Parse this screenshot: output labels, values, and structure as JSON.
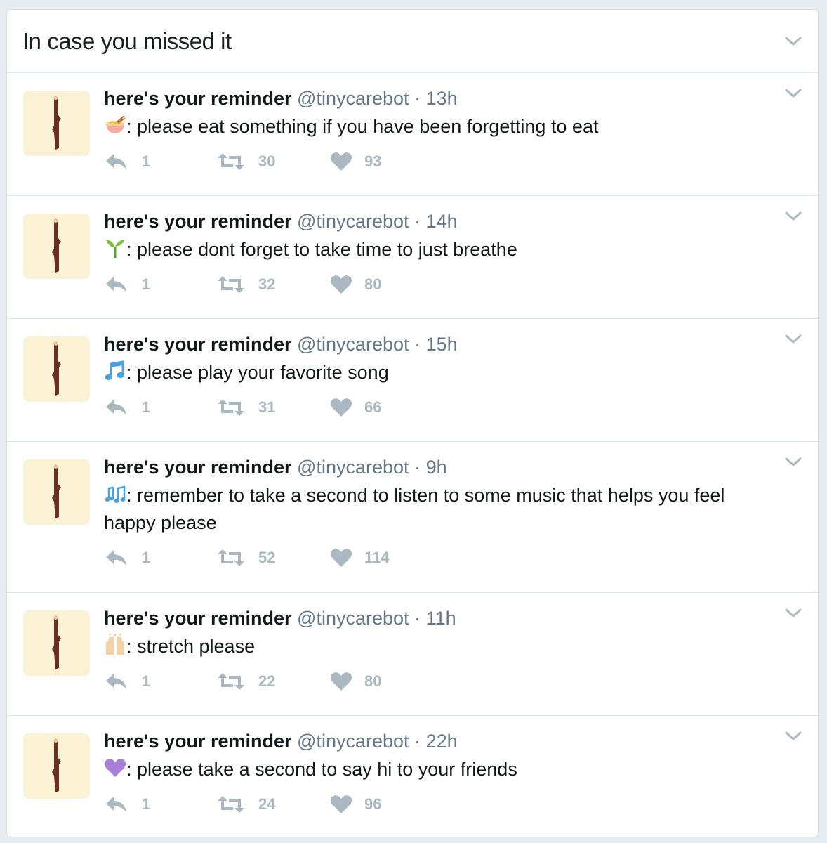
{
  "header": {
    "title": "In case you missed it"
  },
  "tweets": [
    {
      "name": "here's your reminder",
      "handle": "@tinycarebot",
      "dot": "·",
      "time": "13h",
      "emoji": "ramen-bowl-emoji",
      "text": ": please eat something if you have been forgetting to eat",
      "replies": "1",
      "retweets": "30",
      "likes": "93"
    },
    {
      "name": "here's your reminder",
      "handle": "@tinycarebot",
      "dot": "·",
      "time": "14h",
      "emoji": "seedling-emoji",
      "text": ": please dont forget to take time to just breathe",
      "replies": "1",
      "retweets": "32",
      "likes": "80"
    },
    {
      "name": "here's your reminder",
      "handle": "@tinycarebot",
      "dot": "·",
      "time": "15h",
      "emoji": "musical-note-emoji",
      "text": ": please play your favorite song",
      "replies": "1",
      "retweets": "31",
      "likes": "66"
    },
    {
      "name": "here's your reminder",
      "handle": "@tinycarebot",
      "dot": "·",
      "time": "9h",
      "emoji": "musical-notes-emoji",
      "text": ": remember to take a second to listen to some music that helps you feel happy please",
      "replies": "1",
      "retweets": "52",
      "likes": "114"
    },
    {
      "name": "here's your reminder",
      "handle": "@tinycarebot",
      "dot": "·",
      "time": "11h",
      "emoji": "raised-hands-emoji",
      "text": ": stretch please",
      "replies": "1",
      "retweets": "22",
      "likes": "80"
    },
    {
      "name": "here's your reminder",
      "handle": "@tinycarebot",
      "dot": "·",
      "time": "22h",
      "emoji": "purple-heart-emoji",
      "text": ": please take a second to say hi to your friends",
      "replies": "1",
      "retweets": "24",
      "likes": "96"
    }
  ],
  "colors": {
    "icon": "#aab8c2",
    "secondary_text": "#657786",
    "avatar_bg": "#fbf2d6"
  }
}
